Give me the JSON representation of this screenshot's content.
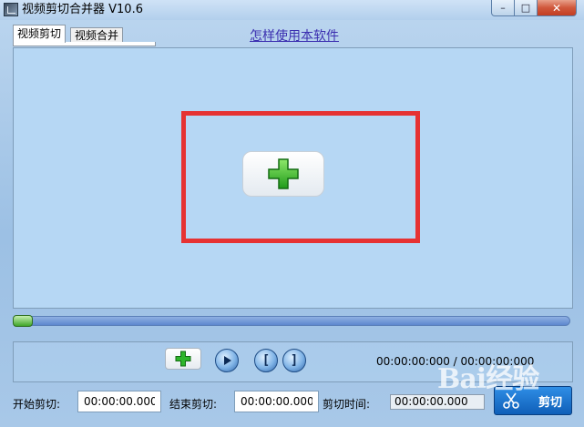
{
  "window": {
    "title": "视频剪切合并器 V10.6",
    "buttons": {
      "minimize": "–",
      "maximize": "□",
      "close": "✕"
    }
  },
  "tabs": [
    {
      "label": "视频剪切",
      "active": true
    },
    {
      "label": "视频合并",
      "active": false
    }
  ],
  "help_link": "怎样使用本软件",
  "video_panel": {
    "add_icon": "green-plus-icon",
    "highlight_color": "#e63232"
  },
  "progress": {
    "position": 0
  },
  "controls": {
    "time_display": "00:00:00:000 / 00:00:00:000",
    "add_icon": "green-plus-icon",
    "play_icon": "play-icon",
    "mark_start_glyph": "[",
    "mark_end_glyph": "]"
  },
  "cut_settings": {
    "start_label": "开始剪切:",
    "start_value": "00:00:00.000",
    "end_label": "结束剪切:",
    "end_value": "00:00:00.000",
    "duration_label": "剪切时间:",
    "duration_value": "00:00:00.000",
    "cut_button": "剪切"
  },
  "watermark": "Bai经验"
}
